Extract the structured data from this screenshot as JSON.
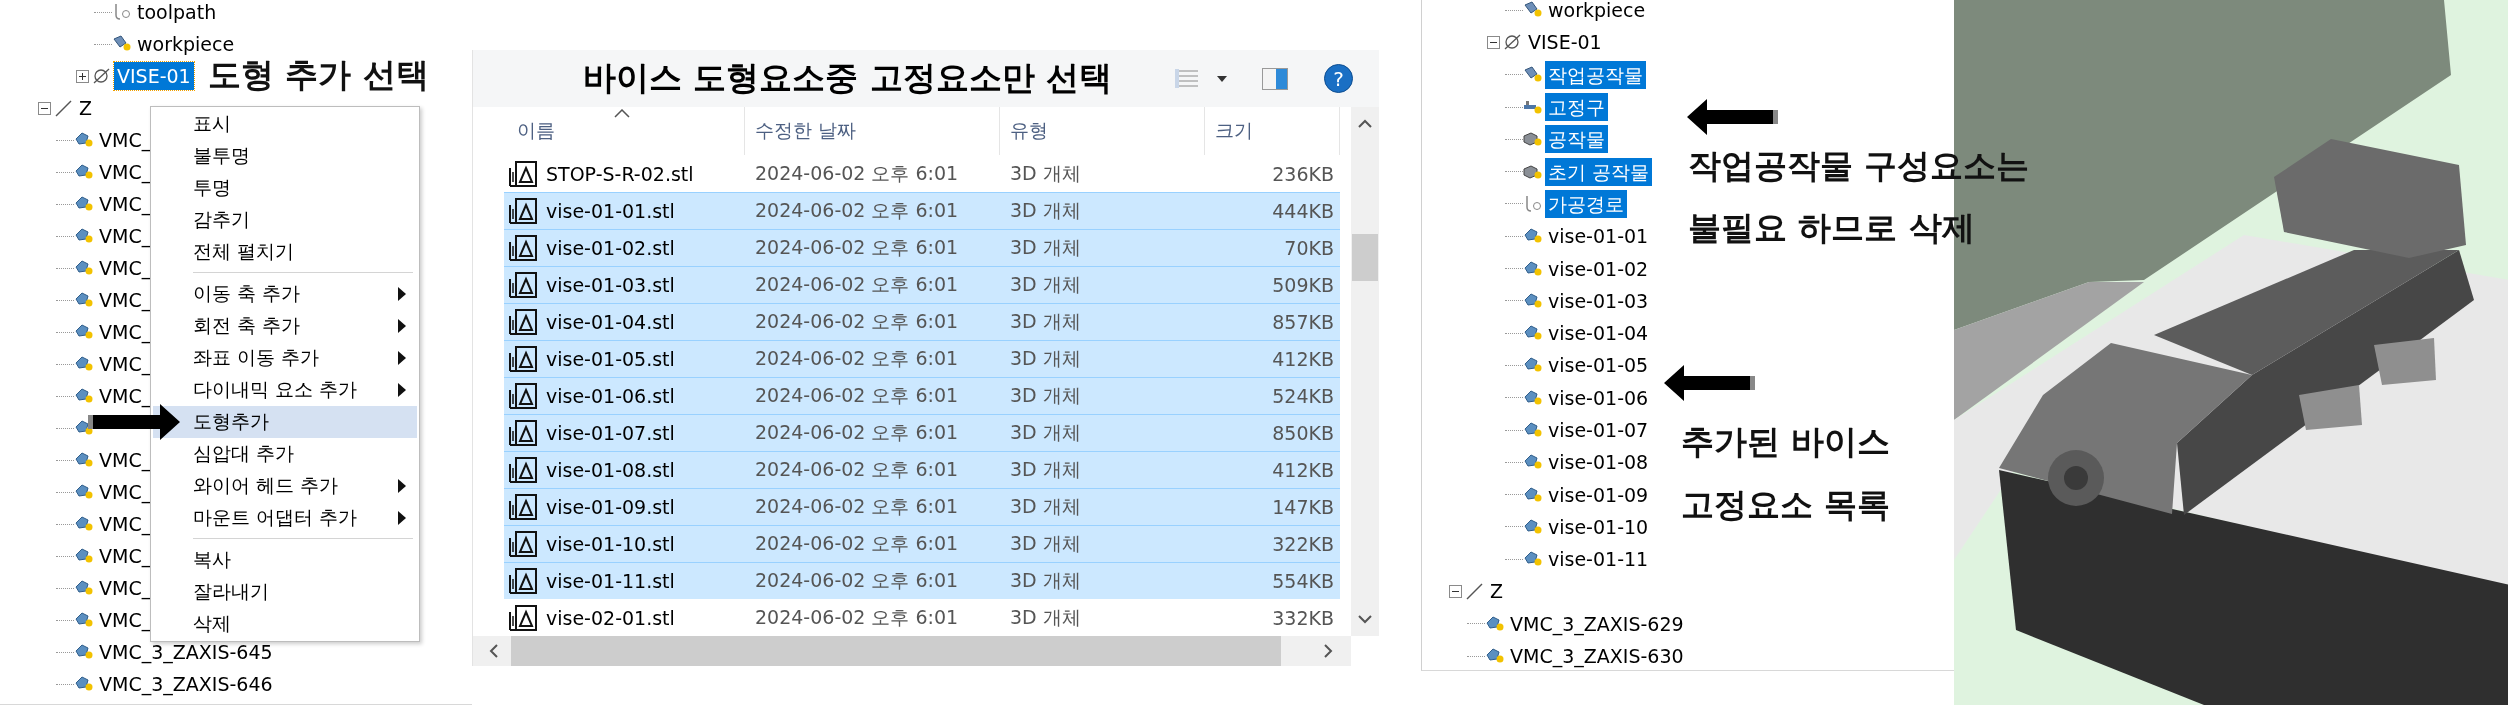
{
  "left_tree": {
    "nodes": [
      {
        "children": [
          {
            "children": [
              {
                "label": "toolpath",
                "kind": "toolpath",
                "selected": false
              },
              {
                "label": "workpiece",
                "kind": "workpiece",
                "selected": false
              }
            ]
          },
          {
            "label": "VISE-01",
            "kind": "vise",
            "expanded": false,
            "selected": true
          }
        ]
      },
      {
        "label": "Z",
        "kind": "axis",
        "expanded": true,
        "selected": false,
        "children": [
          {
            "label": "VMC_",
            "kind": "model",
            "selected": false
          },
          {
            "label": "VMC_",
            "kind": "model",
            "selected": false
          },
          {
            "label": "VMC_",
            "kind": "model",
            "selected": false
          },
          {
            "label": "VMC_",
            "kind": "model",
            "selected": false
          },
          {
            "label": "VMC_",
            "kind": "model",
            "selected": false
          },
          {
            "label": "VMC_",
            "kind": "model",
            "selected": false
          },
          {
            "label": "VMC_",
            "kind": "model",
            "selected": false
          },
          {
            "label": "VMC_",
            "kind": "model",
            "selected": false
          },
          {
            "label": "VMC_",
            "kind": "model",
            "selected": false
          },
          {
            "kind": "model"
          },
          {
            "label": "VMC_",
            "kind": "model",
            "selected": false
          },
          {
            "label": "VMC_",
            "kind": "model",
            "selected": false
          },
          {
            "label": "VMC_",
            "kind": "model",
            "selected": false
          },
          {
            "label": "VMC_",
            "kind": "model",
            "selected": false
          },
          {
            "label": "VMC_",
            "kind": "model",
            "selected": false
          },
          {
            "label": "VMC_",
            "kind": "model",
            "selected": false
          },
          {
            "label": "VMC_3_ZAXIS-645",
            "kind": "model",
            "selected": false
          },
          {
            "label": "VMC_3_ZAXIS-646",
            "kind": "model",
            "selected": false
          }
        ]
      }
    ]
  },
  "context_menu": {
    "items": [
      {
        "kind": "item",
        "label": "표시",
        "submenu": false,
        "selected": false
      },
      {
        "kind": "item",
        "label": "불투명",
        "submenu": false,
        "selected": false
      },
      {
        "kind": "item",
        "label": "투명",
        "submenu": false,
        "selected": false
      },
      {
        "kind": "item",
        "label": "감추기",
        "submenu": false,
        "selected": false
      },
      {
        "kind": "item",
        "label": "전체 펼치기",
        "submenu": false,
        "selected": false
      },
      {
        "kind": "separator"
      },
      {
        "kind": "item",
        "label": "이동 축 추가",
        "submenu": true,
        "selected": false
      },
      {
        "kind": "item",
        "label": "회전 축 추가",
        "submenu": true,
        "selected": false
      },
      {
        "kind": "item",
        "label": "좌표 이동 추가",
        "submenu": true,
        "selected": false
      },
      {
        "kind": "item",
        "label": "다이내믹 요소 추가",
        "submenu": true,
        "selected": false
      },
      {
        "kind": "item",
        "label": "도형추가",
        "submenu": false,
        "selected": true
      },
      {
        "kind": "item",
        "label": "심압대 추가",
        "submenu": false,
        "selected": false
      },
      {
        "kind": "item",
        "label": "와이어 헤드 추가",
        "submenu": true,
        "selected": false
      },
      {
        "kind": "item",
        "label": "마운트 어댑터 추가",
        "submenu": true,
        "selected": false
      },
      {
        "kind": "separator"
      },
      {
        "kind": "item",
        "label": "복사",
        "submenu": false,
        "selected": false
      },
      {
        "kind": "item",
        "label": "잘라내기",
        "submenu": false,
        "selected": false
      },
      {
        "kind": "item",
        "label": "삭제",
        "submenu": false,
        "selected": false
      }
    ]
  },
  "file_dialog": {
    "title": "바이스 도형요소중 고정요소만 선택",
    "help": "?",
    "columns": [
      {
        "label": "이름",
        "sorted": true
      },
      {
        "label": "수정한 날짜",
        "sorted": false
      },
      {
        "label": "유형",
        "sorted": false
      },
      {
        "label": "크기",
        "sorted": false
      }
    ],
    "rows": [
      {
        "name": "STOP-S-R-02.stl",
        "date": "2024-06-02 오후 6:01",
        "type": "3D 개체",
        "size": "236KB",
        "selected": false
      },
      {
        "name": "vise-01-01.stl",
        "date": "2024-06-02 오후 6:01",
        "type": "3D 개체",
        "size": "444KB",
        "selected": true
      },
      {
        "name": "vise-01-02.stl",
        "date": "2024-06-02 오후 6:01",
        "type": "3D 개체",
        "size": "70KB",
        "selected": true
      },
      {
        "name": "vise-01-03.stl",
        "date": "2024-06-02 오후 6:01",
        "type": "3D 개체",
        "size": "509KB",
        "selected": true
      },
      {
        "name": "vise-01-04.stl",
        "date": "2024-06-02 오후 6:01",
        "type": "3D 개체",
        "size": "857KB",
        "selected": true
      },
      {
        "name": "vise-01-05.stl",
        "date": "2024-06-02 오후 6:01",
        "type": "3D 개체",
        "size": "412KB",
        "selected": true
      },
      {
        "name": "vise-01-06.stl",
        "date": "2024-06-02 오후 6:01",
        "type": "3D 개체",
        "size": "524KB",
        "selected": true
      },
      {
        "name": "vise-01-07.stl",
        "date": "2024-06-02 오후 6:01",
        "type": "3D 개체",
        "size": "850KB",
        "selected": true
      },
      {
        "name": "vise-01-08.stl",
        "date": "2024-06-02 오후 6:01",
        "type": "3D 개체",
        "size": "412KB",
        "selected": true
      },
      {
        "name": "vise-01-09.stl",
        "date": "2024-06-02 오후 6:01",
        "type": "3D 개체",
        "size": "147KB",
        "selected": true
      },
      {
        "name": "vise-01-10.stl",
        "date": "2024-06-02 오후 6:01",
        "type": "3D 개체",
        "size": "322KB",
        "selected": true
      },
      {
        "name": "vise-01-11.stl",
        "date": "2024-06-02 오후 6:01",
        "type": "3D 개체",
        "size": "554KB",
        "selected": true
      },
      {
        "name": "vise-02-01.stl",
        "date": "2024-06-02 오후 6:01",
        "type": "3D 개체",
        "size": "332KB",
        "selected": false
      }
    ]
  },
  "right_tree": {
    "nodes": [
      {
        "children": [
          {
            "children": [
              {
                "label": "workpiece",
                "kind": "workpiece",
                "selected": false
              }
            ]
          },
          {
            "label": "VISE-01",
            "kind": "vise",
            "expanded": true,
            "selected": false,
            "children": [
              {
                "label": "작업공작물",
                "kind": "workpiece",
                "selected": true
              },
              {
                "label": "고정구",
                "kind": "fixture",
                "selected": true
              },
              {
                "label": "공작물",
                "kind": "stock",
                "selected": true
              },
              {
                "label": "초기 공작물",
                "kind": "stock",
                "selected": true
              },
              {
                "label": "가공경로",
                "kind": "toolpath",
                "selected": true
              },
              {
                "label": "vise-01-01",
                "kind": "model",
                "selected": false
              },
              {
                "label": "vise-01-02",
                "kind": "model",
                "selected": false
              },
              {
                "label": "vise-01-03",
                "kind": "model",
                "selected": false
              },
              {
                "label": "vise-01-04",
                "kind": "model",
                "selected": false
              },
              {
                "label": "vise-01-05",
                "kind": "model",
                "selected": false
              },
              {
                "label": "vise-01-06",
                "kind": "model",
                "selected": false
              },
              {
                "label": "vise-01-07",
                "kind": "model",
                "selected": false
              },
              {
                "label": "vise-01-08",
                "kind": "model",
                "selected": false
              },
              {
                "label": "vise-01-09",
                "kind": "model",
                "selected": false
              },
              {
                "label": "vise-01-10",
                "kind": "model",
                "selected": false
              },
              {
                "label": "vise-01-11",
                "kind": "model",
                "selected": false
              }
            ]
          }
        ]
      },
      {
        "label": "Z",
        "kind": "axis",
        "expanded": true,
        "selected": false,
        "children": [
          {
            "label": "VMC_3_ZAXIS-629",
            "kind": "model",
            "selected": false
          },
          {
            "label": "VMC_3_ZAXIS-630",
            "kind": "model",
            "selected": false
          }
        ]
      }
    ]
  },
  "annotations": [
    {
      "text": "도형 추가 선택"
    },
    {
      "text": "작업공작물 구성요소는"
    },
    {
      "text": "불필요 하므로 삭제"
    },
    {
      "text": "추가된 바이스"
    },
    {
      "text": "고정요소 목록"
    }
  ]
}
